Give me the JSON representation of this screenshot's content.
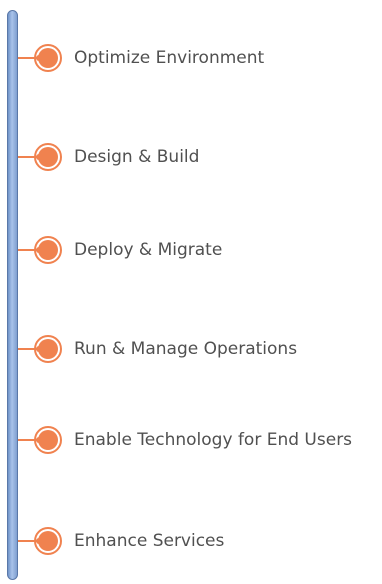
{
  "colors": {
    "accent": "#f0824f",
    "timeline": "#8fb0e0",
    "text": "#505050"
  },
  "steps": [
    {
      "label": "Optimize Environment"
    },
    {
      "label": "Design & Build"
    },
    {
      "label": "Deploy & Migrate"
    },
    {
      "label": "Run & Manage Operations"
    },
    {
      "label": "Enable Technology for End Users"
    },
    {
      "label": "Enhance Services"
    }
  ]
}
